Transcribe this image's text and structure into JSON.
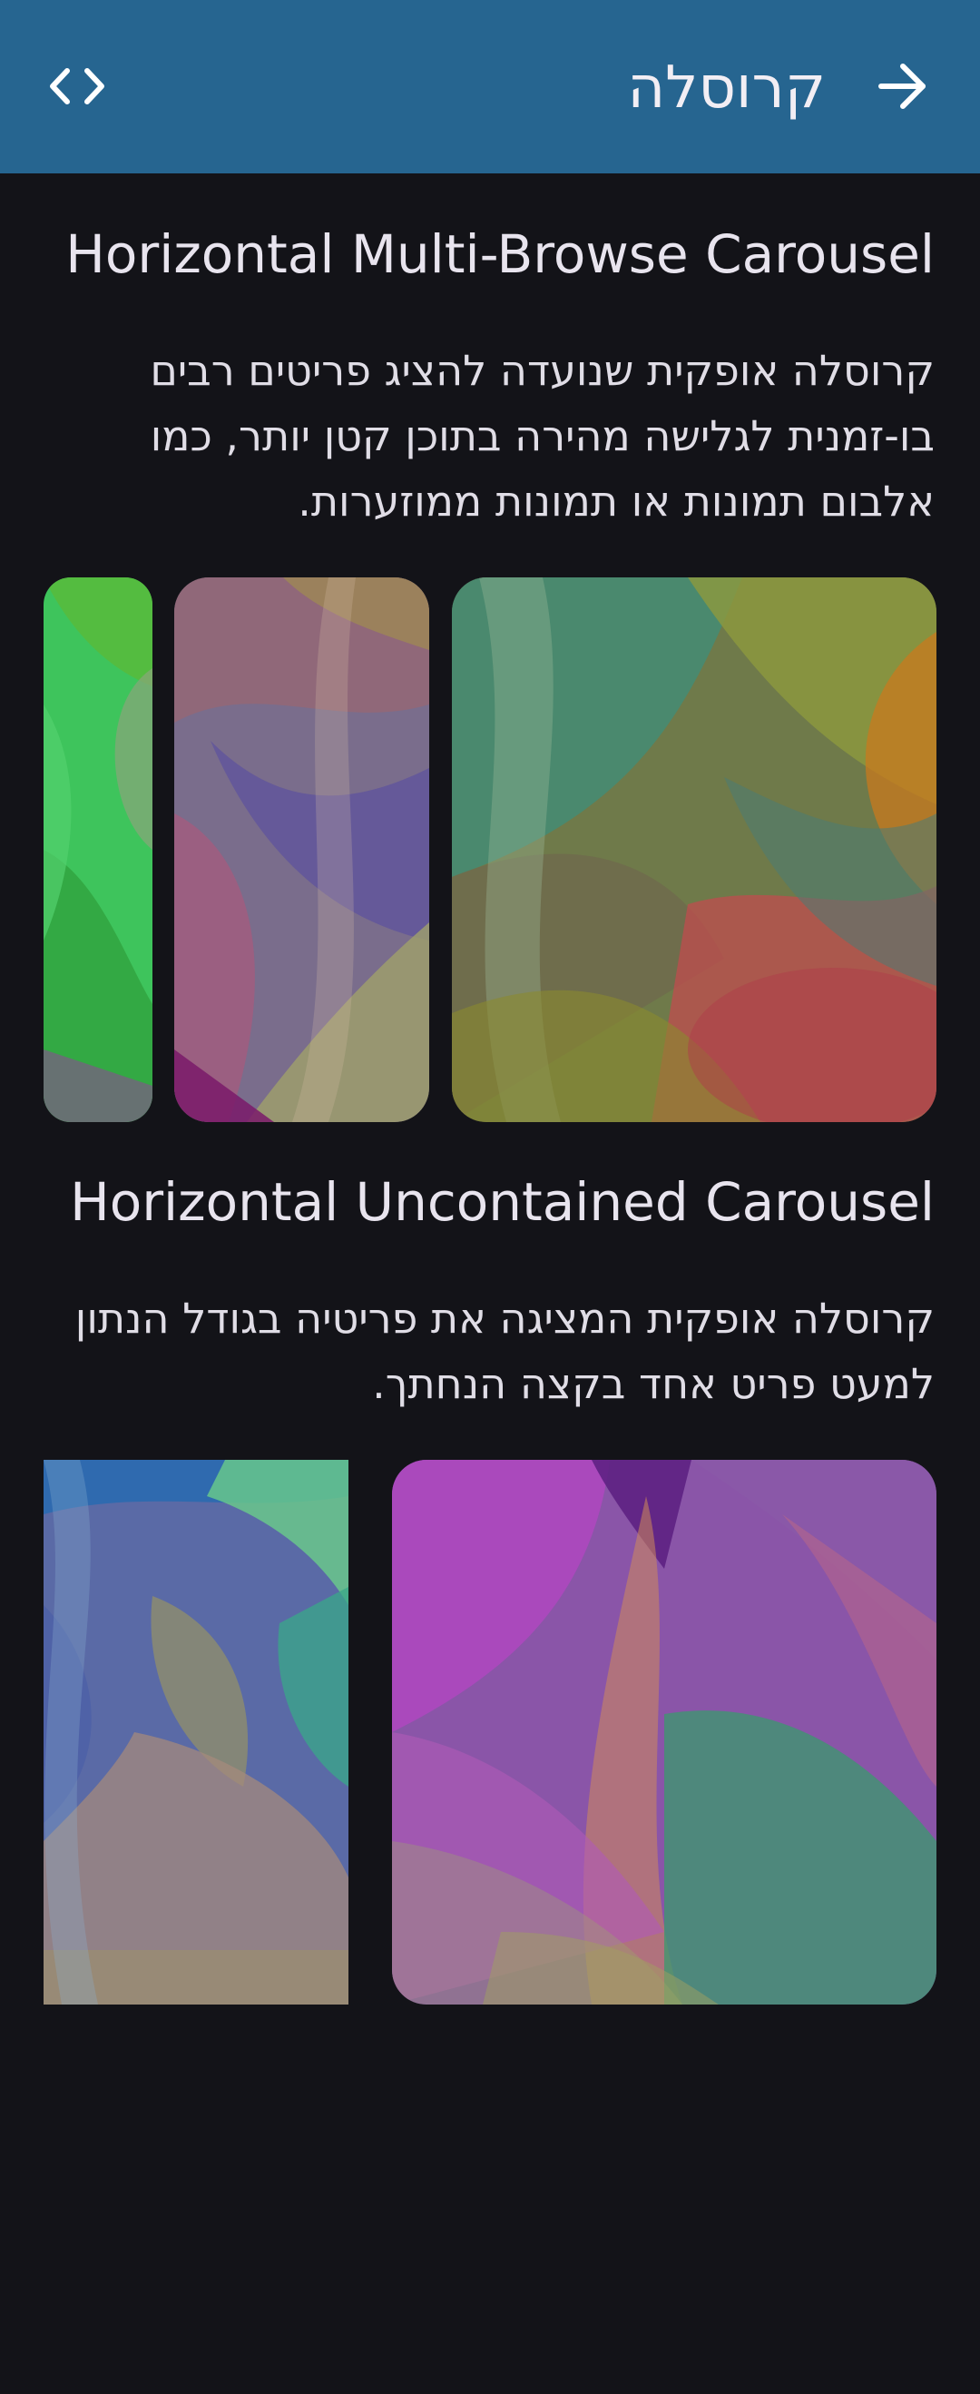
{
  "topbar": {
    "title": "קרוסלה",
    "background": "#266590",
    "icons": {
      "code": "code-icon",
      "back": "arrow-forward-icon"
    }
  },
  "sections": {
    "multi_browse": {
      "title": "Horizontal Multi-Browse Carousel",
      "description": "קרוסלה אופקית שנועדה להציג פריטים רבים בו-זמנית לגלישה מהירה בתוכן קטן יותר, כמו אלבום תמונות או תמונות ממוזערות."
    },
    "uncontained": {
      "title": "Horizontal Uncontained Carousel",
      "description": "קרוסלה אופקית המציגה את פריטיה בגודל הנתון למעט פריט אחד בקצה הנחתך."
    }
  },
  "colors": {
    "background": "#131318",
    "text": "#e4e1e9"
  }
}
